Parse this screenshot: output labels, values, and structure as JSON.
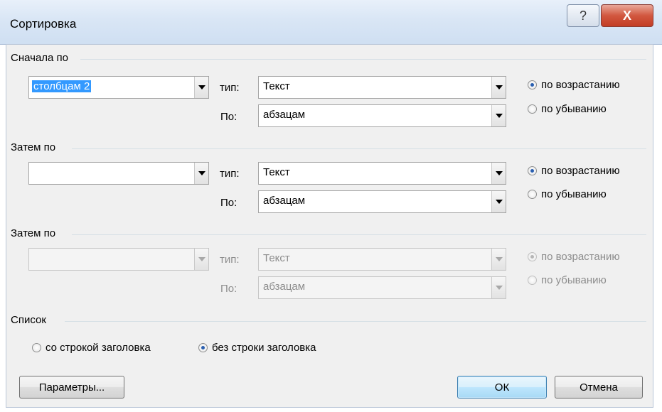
{
  "window": {
    "title": "Сортировка",
    "help_glyph": "?",
    "close_glyph": "X"
  },
  "colors": {
    "accent": "#3399ff",
    "close": "#c33d25",
    "default_button": "#3c7fb1"
  },
  "sort1": {
    "group_label": "Сначала по",
    "field_value": "столбцам 2",
    "type_label": "тип:",
    "type_value": "Текст",
    "by_label": "По:",
    "by_value": "абзацам",
    "asc_label": "по возрастанию",
    "desc_label": "по убыванию",
    "selected": "asc"
  },
  "sort2": {
    "group_label": "Затем по",
    "field_value": "",
    "type_label": "тип:",
    "type_value": "Текст",
    "by_label": "По:",
    "by_value": "абзацам",
    "asc_label": "по возрастанию",
    "desc_label": "по убыванию",
    "selected": "asc"
  },
  "sort3": {
    "group_label": "Затем по",
    "field_value": "",
    "type_label": "тип:",
    "type_value": "Текст",
    "by_label": "По:",
    "by_value": "абзацам",
    "asc_label": "по возрастанию",
    "desc_label": "по убыванию",
    "selected": "asc",
    "disabled": true
  },
  "list": {
    "group_label": "Список",
    "with_header_label": "со строкой заголовка",
    "without_header_label": "без строки заголовка",
    "selected": "without_header"
  },
  "buttons": {
    "params_label": "Параметры...",
    "ok_label": "ОК",
    "cancel_label": "Отмена"
  }
}
